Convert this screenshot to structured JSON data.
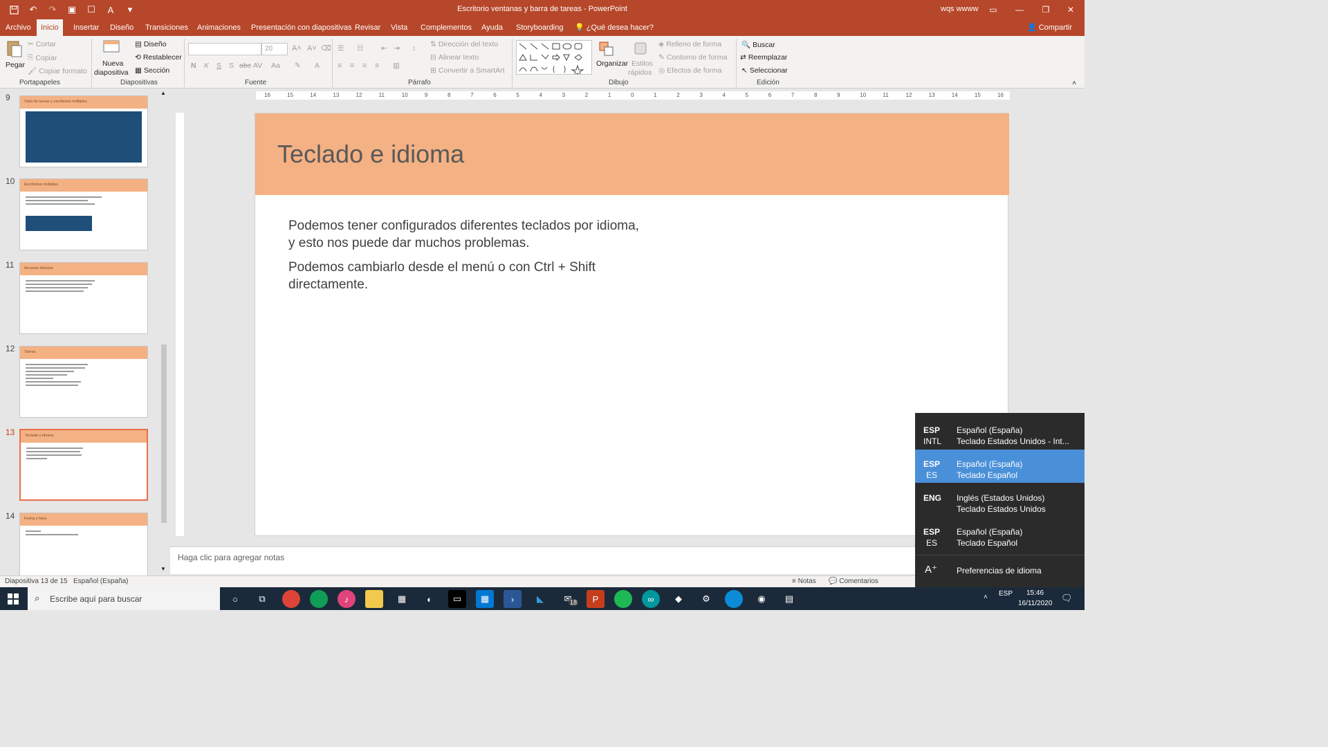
{
  "window": {
    "title": "Escritorio ventanas y barra de tareas - PowerPoint",
    "user": "wqs wwww"
  },
  "tabs": [
    "Archivo",
    "Inicio",
    "Insertar",
    "Diseño",
    "Transiciones",
    "Animaciones",
    "Presentación con diapositivas",
    "Revisar",
    "Vista",
    "Complementos",
    "Ayuda",
    "Storyboarding"
  ],
  "tellme": "¿Qué desea hacer?",
  "share": "Compartir",
  "ribbon": {
    "clipboard": {
      "paste": "Pegar",
      "cut": "Cortar",
      "copy": "Copiar",
      "format_painter": "Copiar formato",
      "label": "Portapapeles"
    },
    "slides": {
      "new_slide_1": "Nueva",
      "new_slide_2": "diapositiva",
      "layout": "Diseño",
      "reset": "Restablecer",
      "section": "Sección",
      "label": "Diapositivas"
    },
    "font": {
      "size": "20",
      "label": "Fuente"
    },
    "paragraph": {
      "text_direction": "Dirección del texto",
      "align_text": "Alinear texto",
      "smartart": "Convertir a SmartArt",
      "label": "Párrafo"
    },
    "drawing": {
      "arrange": "Organizar",
      "quick_styles_1": "Estilos",
      "quick_styles_2": "rápidos",
      "shape_fill": "Relleno de forma",
      "shape_outline": "Contorno de forma",
      "shape_effects": "Efectos de forma",
      "label": "Dibujo"
    },
    "editing": {
      "find": "Buscar",
      "replace": "Reemplazar",
      "select": "Seleccionar",
      "label": "Edición"
    }
  },
  "thumbnails": [
    {
      "num": "9",
      "title": "Vista de tareas y escritorios múltiples"
    },
    {
      "num": "10",
      "title": "Escritorios múltiples"
    },
    {
      "num": "11",
      "title": "Accesos directos"
    },
    {
      "num": "12",
      "title": "Tareas"
    },
    {
      "num": "13",
      "title": "Teclado e idioma",
      "selected": true
    },
    {
      "num": "14",
      "title": "Fecha y hora"
    }
  ],
  "ruler": {
    "horizontal": [
      "16",
      "15",
      "14",
      "13",
      "12",
      "11",
      "10",
      "9",
      "8",
      "7",
      "6",
      "5",
      "4",
      "3",
      "2",
      "1",
      "0",
      "1",
      "2",
      "3",
      "4",
      "5",
      "6",
      "7",
      "8",
      "9",
      "10",
      "11",
      "12",
      "13",
      "14",
      "15",
      "16"
    ]
  },
  "slide": {
    "title": "Teclado e idioma",
    "body": [
      "Podemos tener configurados diferentes teclados por idioma, y esto nos puede dar muchos problemas.",
      "Podemos cambiarlo desde el menú o con Ctrl + Shift directamente."
    ]
  },
  "notes_placeholder": "Haga clic para agregar notas",
  "status": {
    "slide_info": "Diapositiva 13 de 15",
    "language": "Español (España)",
    "notes": "Notas",
    "comments": "Comentarios"
  },
  "language_menu": {
    "items": [
      {
        "code": "ESP",
        "sub": "INTL",
        "lang": "Español (España)",
        "kb": "Teclado Estados Unidos - Int..."
      },
      {
        "code": "ESP",
        "sub": "ES",
        "lang": "Español (España)",
        "kb": "Teclado Español",
        "selected": true
      },
      {
        "code": "ENG",
        "sub": "",
        "lang": "Inglés (Estados Unidos)",
        "kb": "Teclado Estados Unidos"
      },
      {
        "code": "ESP",
        "sub": "ES",
        "lang": "Español (España)",
        "kb": "Teclado Español"
      }
    ],
    "preferences": "Preferencias de idioma"
  },
  "taskbar": {
    "search_placeholder": "Escribe aquí para buscar",
    "mail_badge": "18",
    "tray_lang": "ESP",
    "time": "15:46",
    "date": "16/11/2020"
  },
  "colors": {
    "accent": "#b7472a",
    "slide_header": "#f4b183",
    "selected_lang": "#4a90d9"
  }
}
